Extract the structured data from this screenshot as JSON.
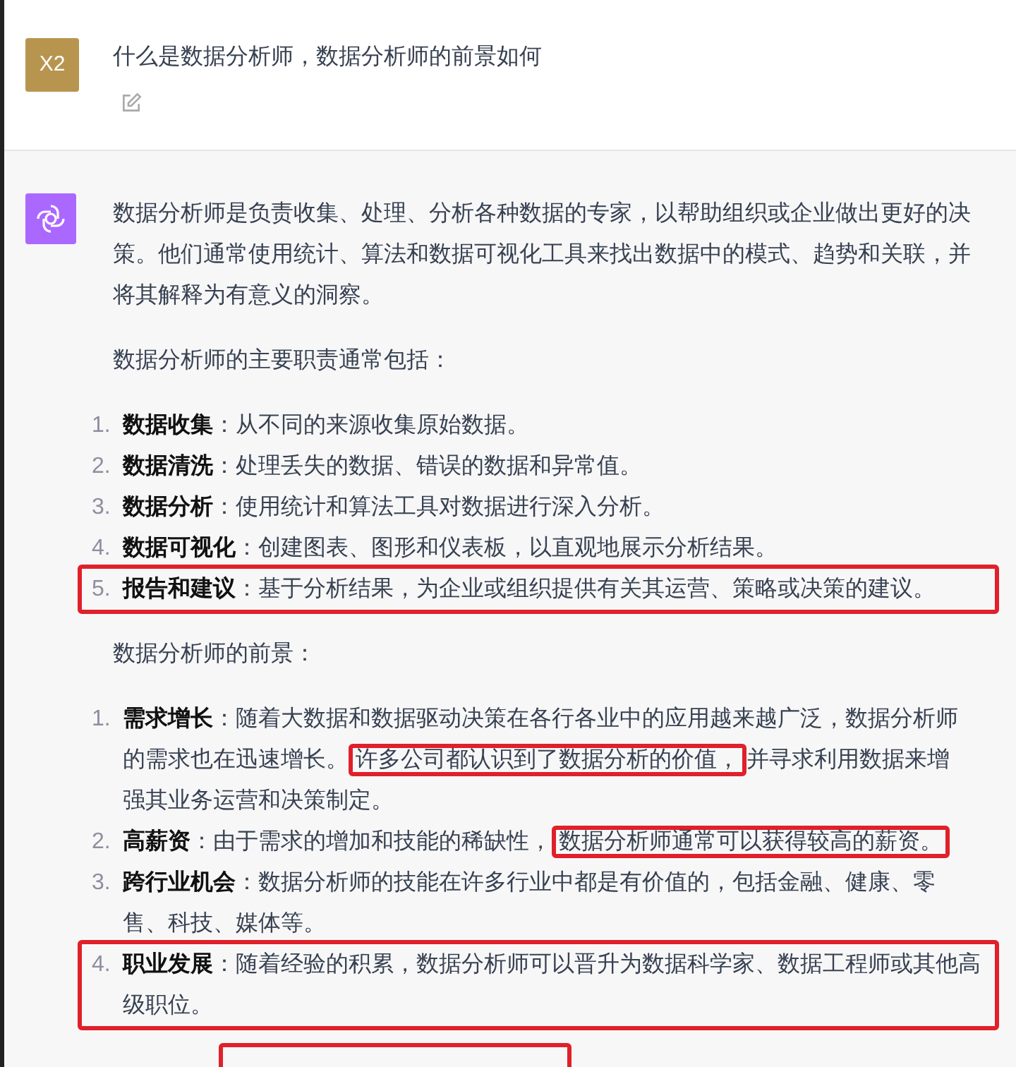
{
  "question": {
    "avatar": "X2",
    "text": "什么是数据分析师，数据分析师的前景如何"
  },
  "answer": {
    "intro": "数据分析师是负责收集、处理、分析各种数据的专家，以帮助组织或企业做出更好的决策。他们通常使用统计、算法和数据可视化工具来找出数据中的模式、趋势和关联，并将其解释为有意义的洞察。",
    "sections": [
      {
        "heading": "数据分析师的主要职责通常包括：",
        "items": [
          {
            "number": "1.",
            "term": "数据收集",
            "marked": false,
            "segments": [
              {
                "text": "：从不同的来源收集原始数据。",
                "marked": false
              }
            ]
          },
          {
            "number": "2.",
            "term": "数据清洗",
            "marked": false,
            "segments": [
              {
                "text": "：处理丢失的数据、错误的数据和异常值。",
                "marked": false
              }
            ]
          },
          {
            "number": "3.",
            "term": "数据分析",
            "marked": false,
            "segments": [
              {
                "text": "：使用统计和算法工具对数据进行深入分析。",
                "marked": false
              }
            ]
          },
          {
            "number": "4.",
            "term": "数据可视化",
            "marked": false,
            "segments": [
              {
                "text": "：创建图表、图形和仪表板，以直观地展示分析结果。",
                "marked": false
              }
            ]
          },
          {
            "number": "5.",
            "term": "报告和建议",
            "marked": true,
            "segments": [
              {
                "text": "：基于分析结果，为企业或组织提供有关其运营、策略或决策的建议。",
                "marked": false
              }
            ]
          }
        ]
      },
      {
        "heading": "数据分析师的前景：",
        "items": [
          {
            "number": "1.",
            "term": "需求增长",
            "marked": false,
            "segments": [
              {
                "text": "：随着大数据和数据驱动决策在各行各业中的应用越来越广泛，数据分析师的需求也在迅速增长。",
                "marked": false
              },
              {
                "text": "许多公司都认识到了数据分析的价值，",
                "marked": true
              },
              {
                "text": "并寻求利用数据来增强其业务运营和决策制定。",
                "marked": false
              }
            ]
          },
          {
            "number": "2.",
            "term": "高薪资",
            "marked": false,
            "segments": [
              {
                "text": "：由于需求的增加和技能的稀缺性，",
                "marked": false
              },
              {
                "text": "数据分析师通常可以获得较高的薪资。",
                "marked": true
              }
            ]
          },
          {
            "number": "3.",
            "term": "跨行业机会",
            "marked": false,
            "segments": [
              {
                "text": "：数据分析师的技能在许多行业中都是有价值的，包括金融、健康、零售、科技、媒体等。",
                "marked": false
              }
            ]
          },
          {
            "number": "4.",
            "term": "职业发展",
            "marked": true,
            "segments": [
              {
                "text": "：随着经验的积累，数据分析师可以晋升为数据科学家、数据工程师或其他高级职位。",
                "marked": false
              }
            ]
          }
        ]
      }
    ],
    "trailing_frame": true
  }
}
